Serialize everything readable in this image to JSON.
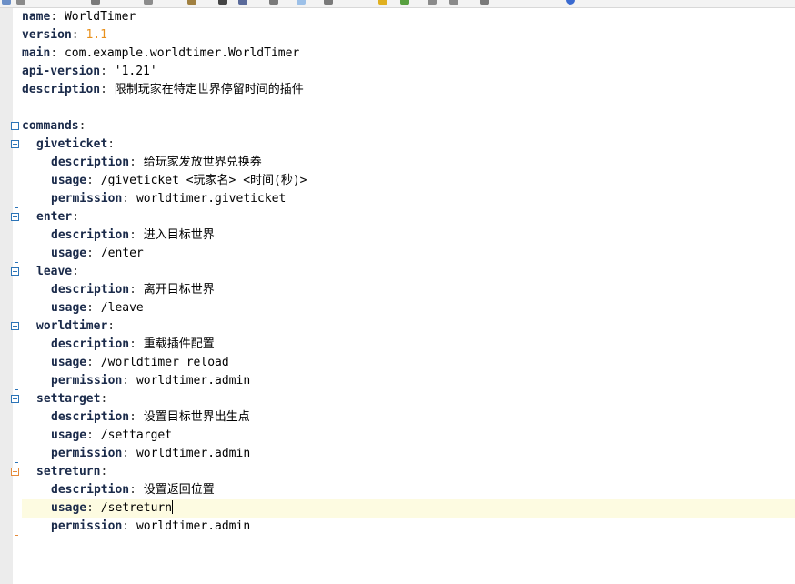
{
  "toolbar": {
    "icons": [
      "save-icon",
      "print-icon",
      "cut-icon",
      "copy-icon",
      "paste-icon",
      "find-icon",
      "replace-icon",
      "bookmark-icon",
      "star-icon",
      "star-add-icon",
      "undo-icon",
      "redo-icon",
      "indent-icon",
      "outdent-icon",
      "run-icon",
      "info-icon"
    ]
  },
  "editor": {
    "lines": {
      "l1": {
        "key": "name",
        "sep": ": ",
        "value": "WorldTimer"
      },
      "l2": {
        "key": "version",
        "sep": ": ",
        "value": "1.1"
      },
      "l3": {
        "key": "main",
        "sep": ": ",
        "value": "com.example.worldtimer.WorldTimer"
      },
      "l4": {
        "key": "api-version",
        "sep": ": ",
        "value": "'1.21'"
      },
      "l5": {
        "key": "description",
        "sep": ": ",
        "value": "限制玩家在特定世界停留时间的插件"
      },
      "l7": {
        "key": "commands",
        "sep": ":"
      },
      "l8": {
        "key": "giveticket",
        "sep": ":"
      },
      "l9": {
        "key": "description",
        "sep": ": ",
        "value": "给玩家发放世界兑换券"
      },
      "l10": {
        "key": "usage",
        "sep": ": ",
        "value": "/giveticket <玩家名> <时间(秒)>"
      },
      "l11": {
        "key": "permission",
        "sep": ": ",
        "value": "worldtimer.giveticket"
      },
      "l12": {
        "key": "enter",
        "sep": ":"
      },
      "l13": {
        "key": "description",
        "sep": ": ",
        "value": "进入目标世界"
      },
      "l14": {
        "key": "usage",
        "sep": ": ",
        "value": "/enter"
      },
      "l15": {
        "key": "leave",
        "sep": ":"
      },
      "l16": {
        "key": "description",
        "sep": ": ",
        "value": "离开目标世界"
      },
      "l17": {
        "key": "usage",
        "sep": ": ",
        "value": "/leave"
      },
      "l18": {
        "key": "worldtimer",
        "sep": ":"
      },
      "l19": {
        "key": "description",
        "sep": ": ",
        "value": "重载插件配置"
      },
      "l20": {
        "key": "usage",
        "sep": ": ",
        "value": "/worldtimer reload"
      },
      "l21": {
        "key": "permission",
        "sep": ": ",
        "value": "worldtimer.admin"
      },
      "l22": {
        "key": "settarget",
        "sep": ":"
      },
      "l23": {
        "key": "description",
        "sep": ": ",
        "value": "设置目标世界出生点"
      },
      "l24": {
        "key": "usage",
        "sep": ": ",
        "value": "/settarget"
      },
      "l25": {
        "key": "permission",
        "sep": ": ",
        "value": "worldtimer.admin"
      },
      "l26": {
        "key": "setreturn",
        "sep": ":"
      },
      "l27": {
        "key": "description",
        "sep": ": ",
        "value": "设置返回位置"
      },
      "l28": {
        "key": "usage",
        "sep": ": ",
        "value": "/setreturn"
      },
      "l29": {
        "key": "permission",
        "sep": ": ",
        "value": "worldtimer.admin"
      }
    }
  },
  "colors": {
    "key": "#1a2a4a",
    "number": "#e8901c",
    "fold": "#2c74b7",
    "fold_active": "#e58a3a",
    "current_line": "#fdfbe1"
  }
}
